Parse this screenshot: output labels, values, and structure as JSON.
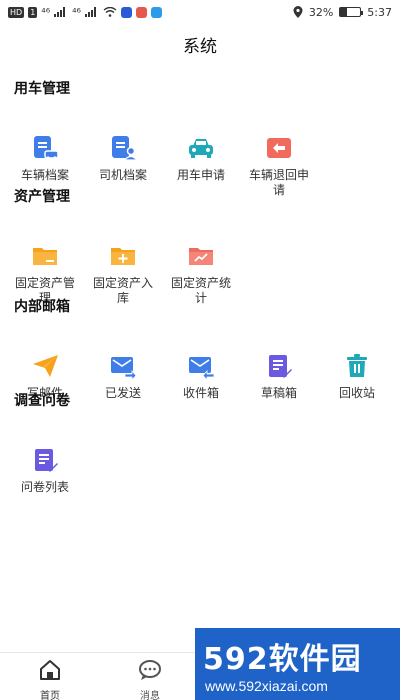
{
  "status_bar": {
    "chips": [
      "HD",
      "1"
    ],
    "signal_1": "⁴⁶",
    "signal_2": "⁴⁶",
    "battery_text": "32%",
    "battery_level": 0.32,
    "time": "5:37"
  },
  "page": {
    "title": "系统"
  },
  "sections": [
    {
      "title": "用车管理",
      "items": [
        {
          "label": "车辆档案",
          "icon": "car-file-icon",
          "color": "#3f7de8"
        },
        {
          "label": "司机档案",
          "icon": "driver-file-icon",
          "color": "#3f7de8"
        },
        {
          "label": "用车申请",
          "icon": "car-request-icon",
          "color": "#1fa9b8"
        },
        {
          "label": "车辆退回申请",
          "icon": "car-return-icon",
          "color": "#f06b5b"
        }
      ]
    },
    {
      "title": "资产管理",
      "items": [
        {
          "label": "固定资产管理",
          "icon": "folder-manage-icon",
          "color": "#f7a21b"
        },
        {
          "label": "固定资产入库",
          "icon": "folder-add-icon",
          "color": "#f7a21b"
        },
        {
          "label": "固定资产统计",
          "icon": "folder-chart-icon",
          "color": "#f06b5b"
        }
      ]
    },
    {
      "title": "内部邮箱",
      "items": [
        {
          "label": "写邮件",
          "icon": "paper-plane-icon",
          "color": "#f7a21b"
        },
        {
          "label": "已发送",
          "icon": "mail-sent-icon",
          "color": "#3f7de8"
        },
        {
          "label": "收件箱",
          "icon": "mail-inbox-icon",
          "color": "#3f7de8"
        },
        {
          "label": "草稿箱",
          "icon": "draft-icon",
          "color": "#6a5ae0"
        },
        {
          "label": "回收站",
          "icon": "trash-icon",
          "color": "#1fa9b8"
        }
      ]
    },
    {
      "title": "调查问卷",
      "items": [
        {
          "label": "问卷列表",
          "icon": "survey-list-icon",
          "color": "#6a5ae0"
        }
      ]
    }
  ],
  "tabbar": {
    "items": [
      {
        "label": "首页",
        "icon": "home-icon"
      },
      {
        "label": "消息",
        "icon": "chat-icon"
      }
    ]
  },
  "watermark": {
    "brand": "592软件园",
    "url": "www.592xiazai.com"
  }
}
